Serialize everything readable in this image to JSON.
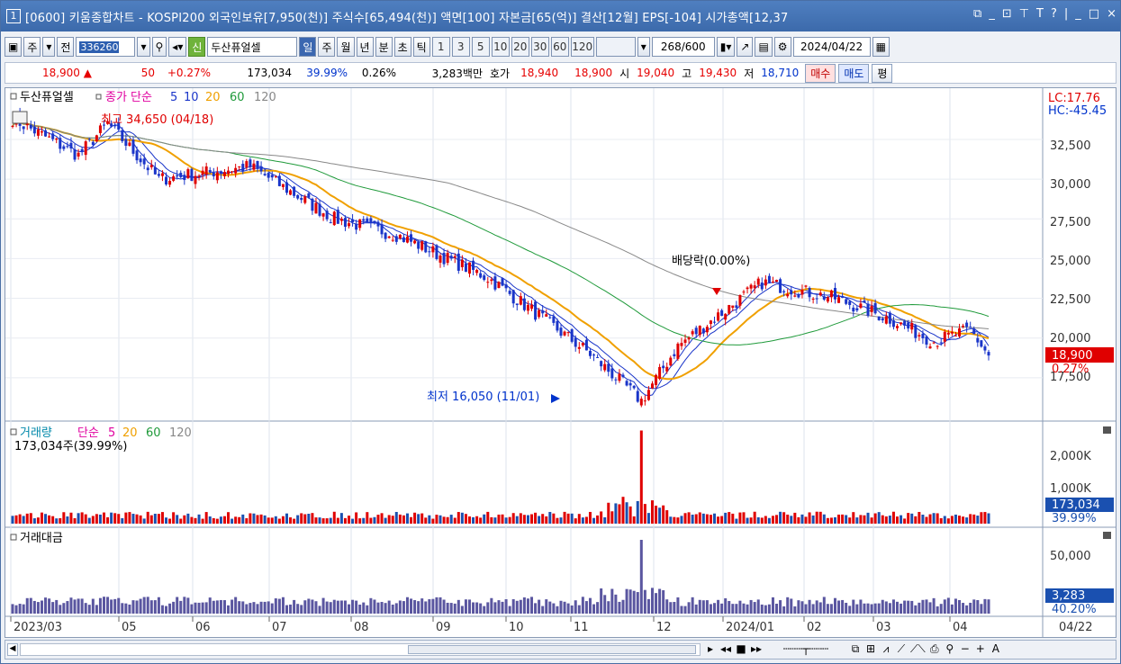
{
  "window": {
    "title_number": "1",
    "title": "[0600] 키움종합차트 - KOSPI200 외국인보유[7,950(천)] 주식수[65,494(천)] 액면[100] 자본금[65(억)] 결산[12월] EPS[-104] 시가총액[12,37",
    "controls": [
      "⧉",
      "_",
      "⊡",
      "⊤",
      "T",
      "?",
      "|",
      "_",
      "□",
      "×"
    ]
  },
  "toolbar": {
    "period_label": "주",
    "prev_label": "전",
    "code_value": "336260",
    "new_label": "신",
    "stock_name": "두산퓨얼셀",
    "intervals": [
      "일",
      "주",
      "월",
      "년",
      "분",
      "초",
      "틱"
    ],
    "numbers": [
      "1",
      "3",
      "5",
      "10",
      "20",
      "30",
      "60",
      "120"
    ],
    "count_value": "268",
    "count_total": "/600",
    "date_value": "2024/04/22"
  },
  "quote": {
    "price": "18,900",
    "change_arrow": "▲",
    "change": "50",
    "change_pct": "+0.27%",
    "volume": "173,034",
    "vol_ratio": "39.99%",
    "turnover": "0.26%",
    "amount": "3,283백만",
    "hoga_label": "호가",
    "ask": "18,940",
    "bid": "18,900",
    "open_label": "시",
    "open": "19,040",
    "high_label": "고",
    "high": "19,430",
    "low_label": "저",
    "low": "18,710",
    "buy_label": "매수",
    "sell_label": "매도",
    "eval_label": "평"
  },
  "price_panel": {
    "legend_name": "두산퓨얼셀",
    "legend_ma_label": "종가 단순",
    "legend_periods": [
      "5",
      "10",
      "20",
      "60",
      "120"
    ],
    "legend_colors": [
      "#1a35c9",
      "#1a35c9",
      "#f0a000",
      "#1f9a3a",
      "#888888"
    ],
    "lc": "LC:17.76",
    "hc": "HC:-45.45",
    "high_note": "최고 34,650 (04/18)",
    "low_note": "최저 16,050 (11/01)",
    "dividend_note": "배당락(0.00%)",
    "yticks": [
      "32,500",
      "30,000",
      "27,500",
      "25,000",
      "22,500",
      "20,000",
      "17,500"
    ],
    "current_price": "18,900",
    "current_pct": "0.27%"
  },
  "volume_panel": {
    "legend_name": "거래량",
    "legend_ma_label": "단순",
    "legend_periods": [
      "5",
      "20",
      "60",
      "120"
    ],
    "legend_colors": [
      "#e000a0",
      "#f0a000",
      "#1f9a3a",
      "#888888"
    ],
    "sub_label": "173,034주(39.99%)",
    "yticks": [
      "2,000K",
      "1,000K"
    ],
    "current_volume": "173,034",
    "current_pct": "39.99%"
  },
  "amount_panel": {
    "legend_name": "거래대금",
    "yticks": [
      "50,000"
    ],
    "current_amount": "3,283",
    "current_pct": "40.20%"
  },
  "xaxis": {
    "labels": [
      "2023/03",
      "05",
      "06",
      "07",
      "08",
      "09",
      "10",
      "11",
      "12",
      "2024/01",
      "02",
      "03",
      "04"
    ],
    "right_label": "04/22"
  },
  "chart_data": {
    "type": "candlestick",
    "title": "두산퓨얼셀",
    "period": "daily",
    "ylim": [
      15000,
      35500
    ],
    "close_series_approx": [
      {
        "x": "2023/03",
        "y": 33800
      },
      {
        "x": "2023/04",
        "y": 31500
      },
      {
        "x": "2023/04/18",
        "y": 33500
      },
      {
        "x": "2023/05",
        "y": 30000
      },
      {
        "x": "2023/06",
        "y": 30800
      },
      {
        "x": "2023/07",
        "y": 27500
      },
      {
        "x": "2023/08",
        "y": 26500
      },
      {
        "x": "2023/09",
        "y": 23800
      },
      {
        "x": "2023/10",
        "y": 19000
      },
      {
        "x": "2023/11/01",
        "y": 16050
      },
      {
        "x": "2023/11",
        "y": 19500
      },
      {
        "x": "2023/12",
        "y": 23500
      },
      {
        "x": "2024/01",
        "y": 22500
      },
      {
        "x": "2024/02",
        "y": 21200
      },
      {
        "x": "2024/03",
        "y": 19800
      },
      {
        "x": "2024/04",
        "y": 20500
      },
      {
        "x": "2024/04/22",
        "y": 18900
      }
    ],
    "series": [
      {
        "name": "5",
        "color": "#1a35c9"
      },
      {
        "name": "10",
        "color": "#1a35c9"
      },
      {
        "name": "20",
        "color": "#f0a000"
      },
      {
        "name": "60",
        "color": "#1f9a3a"
      },
      {
        "name": "120",
        "color": "#888888"
      }
    ],
    "annotations": [
      "최고 34,650 (04/18)",
      "최저 16,050 (11/01)",
      "배당락(0.00%)"
    ]
  }
}
